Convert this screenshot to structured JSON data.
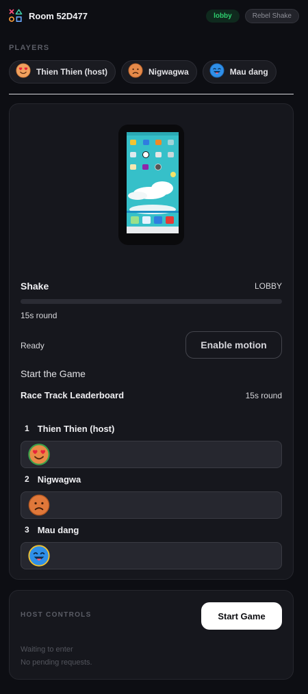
{
  "header": {
    "room_title": "Room 52D477",
    "status_badge": "lobby",
    "game_badge": "Rebel Shake"
  },
  "players_label": "PLAYERS",
  "players": [
    {
      "name": "Thien Thien (host)",
      "emoji": "heart-eyes"
    },
    {
      "name": "Nigwagwa",
      "emoji": "frown"
    },
    {
      "name": "Mau dang",
      "emoji": "tongue-out"
    }
  ],
  "game": {
    "title": "Shake",
    "state": "LOBBY",
    "progress": 0,
    "round": "15s round",
    "motion_status": "Ready",
    "enable_motion_label": "Enable motion",
    "start_title": "Start the Game"
  },
  "leaderboard": {
    "title": "Race Track Leaderboard",
    "round": "15s round",
    "entries": [
      {
        "rank": "1",
        "name": "Thien Thien (host)",
        "emoji": "heart-eyes",
        "progress": 0
      },
      {
        "rank": "2",
        "name": "Nigwagwa",
        "emoji": "frown",
        "progress": 0
      },
      {
        "rank": "3",
        "name": "Mau dang",
        "emoji": "tongue-out",
        "progress": 0
      }
    ]
  },
  "host_controls": {
    "label": "HOST CONTROLS",
    "start_label": "Start Game",
    "waiting_title": "Waiting to enter",
    "pending_text": "No pending requests."
  },
  "colors": {
    "background": "#0d0e13",
    "card": "#16171d",
    "lobby_green": "#2ecf6e",
    "accent": "#5b8cff"
  }
}
